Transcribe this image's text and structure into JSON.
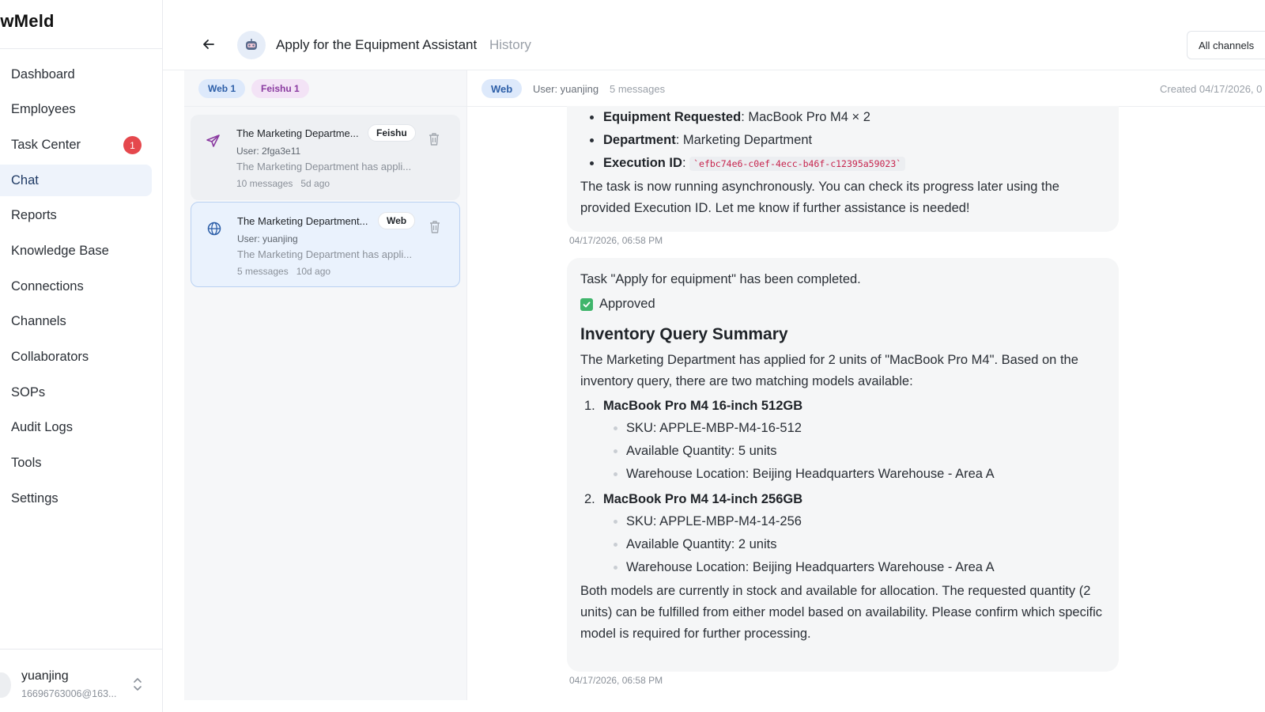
{
  "app": {
    "brand": "ewMeld"
  },
  "sidebar": {
    "items": [
      {
        "label": "Dashboard"
      },
      {
        "label": "Employees"
      },
      {
        "label": "Task Center",
        "badge": "1"
      },
      {
        "label": "Chat",
        "active": true
      },
      {
        "label": "Reports"
      },
      {
        "label": "Knowledge Base"
      },
      {
        "label": "Connections"
      },
      {
        "label": "Channels"
      },
      {
        "label": "Collaborators"
      },
      {
        "label": "SOPs"
      },
      {
        "label": "Audit Logs"
      },
      {
        "label": "Tools"
      },
      {
        "label": "Settings"
      }
    ],
    "user": {
      "name": "yuanjing",
      "email": "16696763006@163..."
    }
  },
  "header": {
    "title": "Apply for the Equipment Assistant",
    "history": "History",
    "channel_filter": "All channels"
  },
  "filters": {
    "web": "Web 1",
    "feishu": "Feishu 1"
  },
  "sessions": [
    {
      "title": "The Marketing Departme...",
      "tag": "Feishu",
      "user": "User: 2fga3e11",
      "preview": "The Marketing Department has appli...",
      "messages": "10 messages",
      "age": "5d ago",
      "icon": "send-icon"
    },
    {
      "title": "The Marketing Department...",
      "tag": "Web",
      "user": "User: yuanjing",
      "preview": "The Marketing Department has appli...",
      "messages": "5 messages",
      "age": "10d ago",
      "icon": "globe-icon"
    }
  ],
  "chat": {
    "channel": "Web",
    "user": "User: yuanjing",
    "count": "5 messages",
    "created": "Created 04/17/2026, 0",
    "msg1": {
      "equip_label": "Equipment Requested",
      "equip_value": ": MacBook Pro M4 × 2",
      "dept_label": "Department",
      "dept_value": ": Marketing Department",
      "exec_label": "Execution ID",
      "exec_value": "`efbc74e6-c0ef-4ecc-b46f-c12395a59023`",
      "body": "The task is now running asynchronously. You can check its progress later using the provided Execution ID. Let me know if further assistance is needed!",
      "time": "04/17/2026, 06:58 PM"
    },
    "msg2": {
      "line1": "Task \"Apply for equipment\" has been completed.",
      "approved": "Approved",
      "heading": "Inventory Query Summary",
      "intro": "The Marketing Department has applied for 2 units of \"MacBook Pro M4\". Based on the inventory query, there are two matching models available:",
      "models": [
        {
          "num": "1.",
          "name": "MacBook Pro M4 16-inch 512GB",
          "sku": "SKU: APPLE-MBP-M4-16-512",
          "qty": "Available Quantity: 5 units",
          "loc": "Warehouse Location: Beijing Headquarters Warehouse - Area A"
        },
        {
          "num": "2.",
          "name": "MacBook Pro M4 14-inch 256GB",
          "sku": "SKU: APPLE-MBP-M4-14-256",
          "qty": "Available Quantity: 2 units",
          "loc": "Warehouse Location: Beijing Headquarters Warehouse - Area A"
        }
      ],
      "closing": "Both models are currently in stock and available for allocation. The requested quantity (2 units) can be fulfilled from either model based on availability. Please confirm which specific model is required for further processing.",
      "time": "04/17/2026, 06:58 PM"
    }
  },
  "colors": {
    "accent": "#2d5fa8",
    "badge": "#e5484d",
    "approved": "#3fb56b",
    "feishu": "#8a3aa0"
  }
}
